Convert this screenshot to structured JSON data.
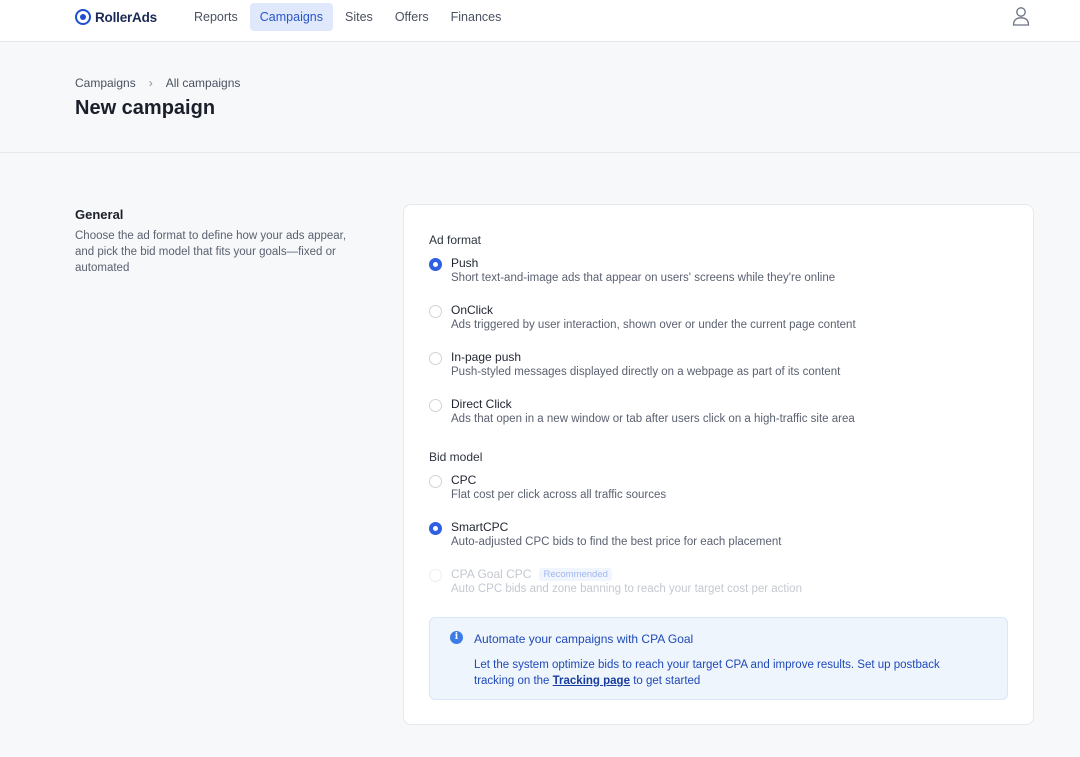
{
  "brand": {
    "name": "RollerAds",
    "accent": "#2f5fe3"
  },
  "nav": [
    {
      "label": "Reports"
    },
    {
      "label": "Campaigns",
      "active": true
    },
    {
      "label": "Sites"
    },
    {
      "label": "Offers"
    },
    {
      "label": "Finances"
    }
  ],
  "breadcrumb": {
    "parent": "Campaigns",
    "separator": "›",
    "current": "All campaigns"
  },
  "page": {
    "title": "New campaign"
  },
  "general": {
    "title": "General",
    "description": "Choose the ad format to define how your ads appear, and pick the bid model that fits your goals—fixed or automated"
  },
  "ad_format": {
    "label": "Ad format",
    "options": [
      {
        "title": "Push",
        "desc": "Short text-and-image ads that appear on users' screens while they're online",
        "checked": true
      },
      {
        "title": "OnClick",
        "desc": "Ads triggered by user interaction, shown over or under the current page content",
        "checked": false
      },
      {
        "title": "In-page push",
        "desc": "Push-styled messages displayed directly on a webpage as part of its content",
        "checked": false
      },
      {
        "title": "Direct Click",
        "desc": "Ads that open in a new window or tab after users click on a high-traffic site area",
        "checked": false
      }
    ]
  },
  "bid_model": {
    "label": "Bid model",
    "options": [
      {
        "title": "CPC",
        "desc": "Flat cost per click across all traffic sources",
        "checked": false
      },
      {
        "title": "SmartCPC",
        "desc": "Auto-adjusted CPC bids to find the best price for each placement",
        "checked": true
      },
      {
        "title": "CPA Goal CPC",
        "badge": "Recommended",
        "desc": "Auto CPC bids and zone banning to reach your target cost per action",
        "checked": false,
        "disabled": true
      }
    ]
  },
  "info": {
    "icon": "info-icon",
    "title": "Automate your campaigns with CPA Goal",
    "body_before": "Let the system optimize bids to reach your target CPA and improve results. Set up postback tracking on the",
    "link": "Tracking page",
    "body_after": "to get started"
  }
}
